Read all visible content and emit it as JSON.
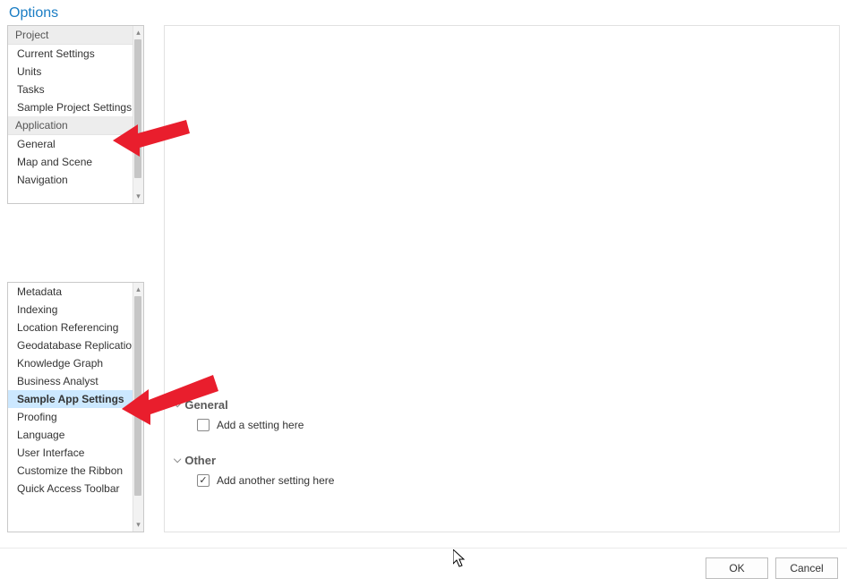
{
  "window": {
    "title": "Options"
  },
  "sidebar_top": {
    "groups": [
      {
        "header": "Project",
        "items": [
          "Current Settings",
          "Units",
          "Tasks",
          "Sample Project Settings"
        ]
      },
      {
        "header": "Application",
        "items": [
          "General",
          "Map and Scene",
          "Navigation"
        ]
      }
    ]
  },
  "sidebar_bottom": {
    "items": [
      "Metadata",
      "Indexing",
      "Location Referencing",
      "Geodatabase Replication",
      "Knowledge Graph",
      "Business Analyst",
      "Sample App Settings",
      "Proofing",
      "Language",
      "User Interface",
      "Customize the Ribbon",
      "Quick Access Toolbar"
    ],
    "selected_index": 6
  },
  "content": {
    "section1": {
      "title": "General",
      "checkbox_label": "Add a setting here",
      "checked": false
    },
    "section2": {
      "title": "Other",
      "checkbox_label": "Add another setting here",
      "checked": true
    }
  },
  "footer": {
    "ok": "OK",
    "cancel": "Cancel"
  }
}
